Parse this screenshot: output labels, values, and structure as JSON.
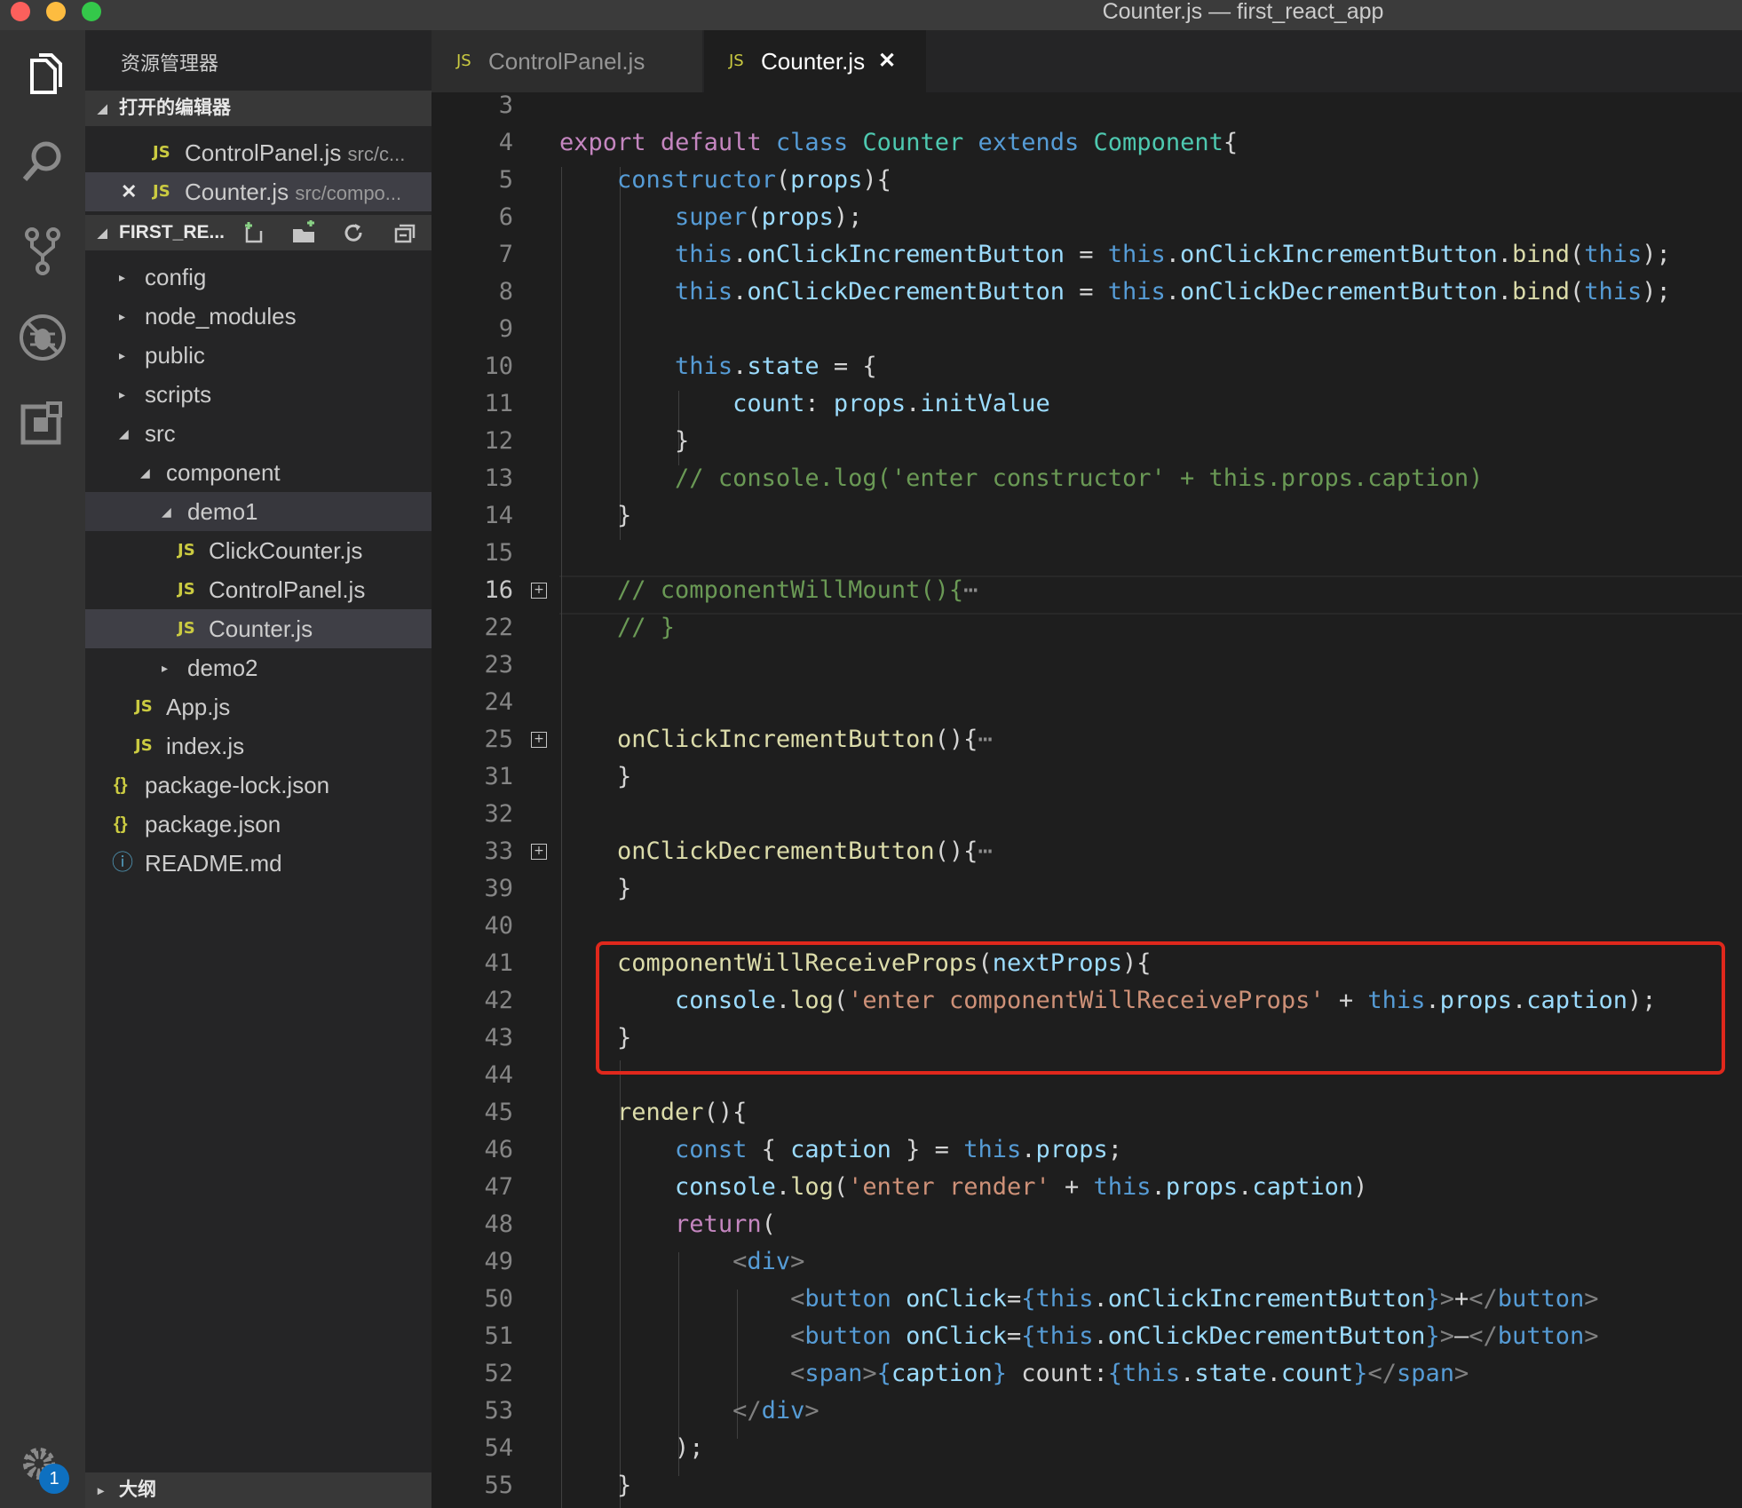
{
  "window": {
    "title": "Counter.js — first_react_app"
  },
  "explorer": {
    "title": "资源管理器",
    "open_editors_label": "打开的编辑器",
    "open_editors": [
      {
        "icon": "JS",
        "name": "ControlPanel.js",
        "desc": "src/c...",
        "close": ""
      },
      {
        "icon": "JS",
        "name": "Counter.js",
        "desc": "src/compo...",
        "close": "✕"
      }
    ],
    "project_label": "FIRST_RE...",
    "outline_label": "大纲",
    "tree": [
      {
        "arrow": "▸",
        "icon": "",
        "name": "config"
      },
      {
        "arrow": "▸",
        "icon": "",
        "name": "node_modules"
      },
      {
        "arrow": "▸",
        "icon": "",
        "name": "public"
      },
      {
        "arrow": "▸",
        "icon": "",
        "name": "scripts"
      },
      {
        "arrow": "◢",
        "icon": "",
        "name": "src"
      },
      {
        "arrow": "◢",
        "icon": "",
        "name": "component"
      },
      {
        "arrow": "◢",
        "icon": "",
        "name": "demo1"
      },
      {
        "arrow": "",
        "icon": "JS",
        "name": "ClickCounter.js"
      },
      {
        "arrow": "",
        "icon": "JS",
        "name": "ControlPanel.js"
      },
      {
        "arrow": "",
        "icon": "JS",
        "name": "Counter.js"
      },
      {
        "arrow": "▸",
        "icon": "",
        "name": "demo2"
      },
      {
        "arrow": "",
        "icon": "JS",
        "name": "App.js"
      },
      {
        "arrow": "",
        "icon": "JS",
        "name": "index.js"
      },
      {
        "arrow": "",
        "icon": "{}",
        "name": "package-lock.json"
      },
      {
        "arrow": "",
        "icon": "{}",
        "name": "package.json"
      },
      {
        "arrow": "",
        "icon": "ⓘ",
        "name": "README.md"
      }
    ]
  },
  "activity": {
    "icons": [
      "files-icon",
      "search-icon",
      "source-control-icon",
      "debug-icon",
      "extensions-icon",
      "settings-gear-icon"
    ],
    "badge": "1"
  },
  "tabs": [
    {
      "icon": "JS",
      "label": "ControlPanel.js",
      "active": false,
      "close": ""
    },
    {
      "icon": "JS",
      "label": "Counter.js",
      "active": true,
      "close": "✕"
    }
  ],
  "editor": {
    "lines": [
      {
        "n": "3",
        "tokens": []
      },
      {
        "n": "4",
        "tokens": [
          [
            "kw",
            "export"
          ],
          [
            "p",
            " "
          ],
          [
            "kw",
            "default"
          ],
          [
            "p",
            " "
          ],
          [
            "st",
            "class"
          ],
          [
            "p",
            " "
          ],
          [
            "cls",
            "Counter"
          ],
          [
            "p",
            " "
          ],
          [
            "st",
            "extends"
          ],
          [
            "p",
            " "
          ],
          [
            "cls",
            "Component"
          ],
          [
            "p",
            "{"
          ]
        ]
      },
      {
        "n": "5",
        "tokens": [
          [
            "p",
            "    "
          ],
          [
            "st",
            "constructor"
          ],
          [
            "p",
            "("
          ],
          [
            "vr",
            "props"
          ],
          [
            "p",
            "){"
          ]
        ]
      },
      {
        "n": "6",
        "tokens": [
          [
            "p",
            "        "
          ],
          [
            "st",
            "super"
          ],
          [
            "p",
            "("
          ],
          [
            "vr",
            "props"
          ],
          [
            "p",
            ");"
          ]
        ]
      },
      {
        "n": "7",
        "tokens": [
          [
            "p",
            "        "
          ],
          [
            "st",
            "this"
          ],
          [
            "p",
            "."
          ],
          [
            "vr",
            "onClickIncrementButton"
          ],
          [
            "p",
            " = "
          ],
          [
            "st",
            "this"
          ],
          [
            "p",
            "."
          ],
          [
            "vr",
            "onClickIncrementButton"
          ],
          [
            "p",
            "."
          ],
          [
            "fn",
            "bind"
          ],
          [
            "p",
            "("
          ],
          [
            "st",
            "this"
          ],
          [
            "p",
            ");"
          ]
        ]
      },
      {
        "n": "8",
        "tokens": [
          [
            "p",
            "        "
          ],
          [
            "st",
            "this"
          ],
          [
            "p",
            "."
          ],
          [
            "vr",
            "onClickDecrementButton"
          ],
          [
            "p",
            " = "
          ],
          [
            "st",
            "this"
          ],
          [
            "p",
            "."
          ],
          [
            "vr",
            "onClickDecrementButton"
          ],
          [
            "p",
            "."
          ],
          [
            "fn",
            "bind"
          ],
          [
            "p",
            "("
          ],
          [
            "st",
            "this"
          ],
          [
            "p",
            ");"
          ]
        ]
      },
      {
        "n": "9",
        "tokens": []
      },
      {
        "n": "10",
        "tokens": [
          [
            "p",
            "        "
          ],
          [
            "st",
            "this"
          ],
          [
            "p",
            "."
          ],
          [
            "vr",
            "state"
          ],
          [
            "p",
            " = {"
          ]
        ]
      },
      {
        "n": "11",
        "tokens": [
          [
            "p",
            "            "
          ],
          [
            "vr",
            "count"
          ],
          [
            "p",
            ": "
          ],
          [
            "vr",
            "props"
          ],
          [
            "p",
            "."
          ],
          [
            "vr",
            "initValue"
          ]
        ]
      },
      {
        "n": "12",
        "tokens": [
          [
            "p",
            "        }"
          ]
        ]
      },
      {
        "n": "13",
        "tokens": [
          [
            "p",
            "        "
          ],
          [
            "cm",
            "// console.log('enter constructor' + this.props.caption)"
          ]
        ]
      },
      {
        "n": "14",
        "tokens": [
          [
            "p",
            "    }"
          ]
        ]
      },
      {
        "n": "15",
        "tokens": []
      },
      {
        "n": "16",
        "fold": "+",
        "cur": true,
        "tokens": [
          [
            "p",
            "    "
          ],
          [
            "cm",
            "// componentWillMount(){"
          ],
          [
            "ell",
            "⋯"
          ]
        ]
      },
      {
        "n": "22",
        "tokens": [
          [
            "p",
            "    "
          ],
          [
            "cm",
            "// }"
          ]
        ]
      },
      {
        "n": "23",
        "tokens": []
      },
      {
        "n": "24",
        "tokens": []
      },
      {
        "n": "25",
        "fold": "+",
        "tokens": [
          [
            "p",
            "    "
          ],
          [
            "fn",
            "onClickIncrementButton"
          ],
          [
            "p",
            "(){"
          ],
          [
            "ell",
            "⋯"
          ]
        ]
      },
      {
        "n": "31",
        "tokens": [
          [
            "p",
            "    }"
          ]
        ]
      },
      {
        "n": "32",
        "tokens": []
      },
      {
        "n": "33",
        "fold": "+",
        "tokens": [
          [
            "p",
            "    "
          ],
          [
            "fn",
            "onClickDecrementButton"
          ],
          [
            "p",
            "(){"
          ],
          [
            "ell",
            "⋯"
          ]
        ]
      },
      {
        "n": "39",
        "tokens": [
          [
            "p",
            "    }"
          ]
        ]
      },
      {
        "n": "40",
        "tokens": []
      },
      {
        "n": "41",
        "tokens": [
          [
            "p",
            "    "
          ],
          [
            "fn",
            "componentWillReceiveProps"
          ],
          [
            "p",
            "("
          ],
          [
            "vr",
            "nextProps"
          ],
          [
            "p",
            "){"
          ]
        ]
      },
      {
        "n": "42",
        "tokens": [
          [
            "p",
            "        "
          ],
          [
            "vr",
            "console"
          ],
          [
            "p",
            "."
          ],
          [
            "fn",
            "log"
          ],
          [
            "p",
            "("
          ],
          [
            "str",
            "'enter componentWillReceiveProps'"
          ],
          [
            "p",
            " + "
          ],
          [
            "st",
            "this"
          ],
          [
            "p",
            "."
          ],
          [
            "vr",
            "props"
          ],
          [
            "p",
            "."
          ],
          [
            "vr",
            "caption"
          ],
          [
            "p",
            ");"
          ]
        ]
      },
      {
        "n": "43",
        "tokens": [
          [
            "p",
            "    }"
          ]
        ]
      },
      {
        "n": "44",
        "tokens": []
      },
      {
        "n": "45",
        "tokens": [
          [
            "p",
            "    "
          ],
          [
            "fn",
            "render"
          ],
          [
            "p",
            "(){"
          ]
        ]
      },
      {
        "n": "46",
        "tokens": [
          [
            "p",
            "        "
          ],
          [
            "st",
            "const"
          ],
          [
            "p",
            " { "
          ],
          [
            "vr",
            "caption"
          ],
          [
            "p",
            " } = "
          ],
          [
            "st",
            "this"
          ],
          [
            "p",
            "."
          ],
          [
            "vr",
            "props"
          ],
          [
            "p",
            ";"
          ]
        ]
      },
      {
        "n": "47",
        "tokens": [
          [
            "p",
            "        "
          ],
          [
            "vr",
            "console"
          ],
          [
            "p",
            "."
          ],
          [
            "fn",
            "log"
          ],
          [
            "p",
            "("
          ],
          [
            "str",
            "'enter render'"
          ],
          [
            "p",
            " + "
          ],
          [
            "st",
            "this"
          ],
          [
            "p",
            "."
          ],
          [
            "vr",
            "props"
          ],
          [
            "p",
            "."
          ],
          [
            "vr",
            "caption"
          ],
          [
            "p",
            ")"
          ]
        ]
      },
      {
        "n": "48",
        "tokens": [
          [
            "p",
            "        "
          ],
          [
            "kw",
            "return"
          ],
          [
            "p",
            "("
          ]
        ]
      },
      {
        "n": "49",
        "tokens": [
          [
            "p",
            "            "
          ],
          [
            "tb",
            "<"
          ],
          [
            "tg",
            "div"
          ],
          [
            "tb",
            ">"
          ]
        ]
      },
      {
        "n": "50",
        "tokens": [
          [
            "p",
            "                "
          ],
          [
            "tb",
            "<"
          ],
          [
            "tg",
            "button"
          ],
          [
            "p",
            " "
          ],
          [
            "vr",
            "onClick"
          ],
          [
            "p",
            "="
          ],
          [
            "st",
            "{"
          ],
          [
            "st",
            "this"
          ],
          [
            "p",
            "."
          ],
          [
            "vr",
            "onClickIncrementButton"
          ],
          [
            "st",
            "}"
          ],
          [
            "tb",
            ">"
          ],
          [
            "p",
            "+"
          ],
          [
            "tb",
            "</"
          ],
          [
            "tg",
            "button"
          ],
          [
            "tb",
            ">"
          ]
        ]
      },
      {
        "n": "51",
        "tokens": [
          [
            "p",
            "                "
          ],
          [
            "tb",
            "<"
          ],
          [
            "tg",
            "button"
          ],
          [
            "p",
            " "
          ],
          [
            "vr",
            "onClick"
          ],
          [
            "p",
            "="
          ],
          [
            "st",
            "{"
          ],
          [
            "st",
            "this"
          ],
          [
            "p",
            "."
          ],
          [
            "vr",
            "onClickDecrementButton"
          ],
          [
            "st",
            "}"
          ],
          [
            "tb",
            ">"
          ],
          [
            "p",
            "—"
          ],
          [
            "tb",
            "</"
          ],
          [
            "tg",
            "button"
          ],
          [
            "tb",
            ">"
          ]
        ]
      },
      {
        "n": "52",
        "tokens": [
          [
            "p",
            "                "
          ],
          [
            "tb",
            "<"
          ],
          [
            "tg",
            "span"
          ],
          [
            "tb",
            ">"
          ],
          [
            "st",
            "{"
          ],
          [
            "vr",
            "caption"
          ],
          [
            "st",
            "}"
          ],
          [
            "p",
            " count:"
          ],
          [
            "st",
            "{"
          ],
          [
            "st",
            "this"
          ],
          [
            "p",
            "."
          ],
          [
            "vr",
            "state"
          ],
          [
            "p",
            "."
          ],
          [
            "vr",
            "count"
          ],
          [
            "st",
            "}"
          ],
          [
            "tb",
            "</"
          ],
          [
            "tg",
            "span"
          ],
          [
            "tb",
            ">"
          ]
        ]
      },
      {
        "n": "53",
        "tokens": [
          [
            "p",
            "            "
          ],
          [
            "tb",
            "</"
          ],
          [
            "tg",
            "div"
          ],
          [
            "tb",
            ">"
          ]
        ]
      },
      {
        "n": "54",
        "tokens": [
          [
            "p",
            "        );"
          ]
        ]
      },
      {
        "n": "55",
        "tokens": [
          [
            "p",
            "    }"
          ]
        ]
      }
    ]
  },
  "colors": {
    "keyword": "#c586c0",
    "storage": "#569cd6",
    "class": "#4ec9b0",
    "function": "#dcdcaa",
    "variable": "#9cdcfe",
    "string": "#ce9178",
    "comment": "#6a9955",
    "highlight_box": "#e0281c"
  }
}
